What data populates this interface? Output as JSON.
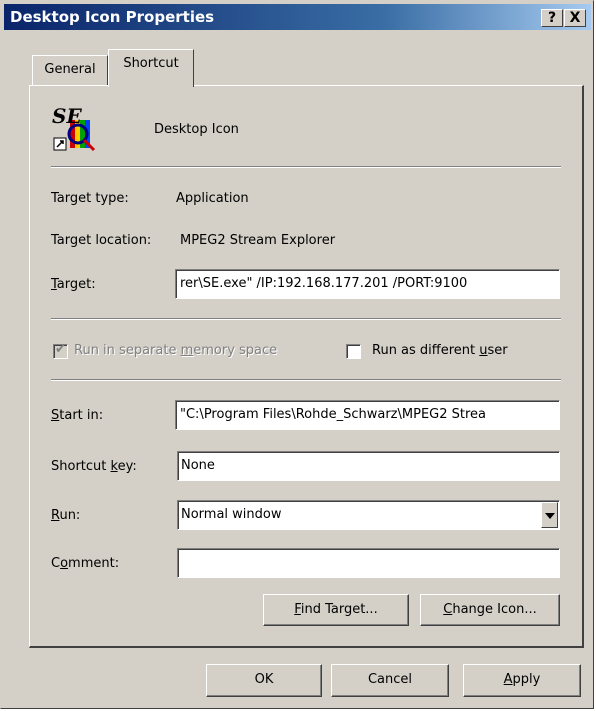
{
  "window": {
    "title": "Desktop Icon Properties",
    "help_label": "?",
    "close_label": "X"
  },
  "tabs": [
    {
      "label": "General"
    },
    {
      "label": "Shortcut"
    }
  ],
  "shortcut": {
    "name": "Desktop Icon",
    "icon_text": "SE",
    "target_type_label": "Target type:",
    "target_type_value": "Application",
    "target_location_label": "Target location:",
    "target_location_value": "MPEG2 Stream Explorer",
    "target_label_pre": "",
    "target_label_u": "T",
    "target_label_post": "arget:",
    "target_value": "rer\\SE.exe\" /IP:192.168.177.201 /PORT:9100",
    "run_separate_pre": "Run in separate ",
    "run_separate_u": "m",
    "run_separate_post": "emory space",
    "run_separate_checked": true,
    "run_as_pre": "Run as different ",
    "run_as_u": "u",
    "run_as_post": "ser",
    "run_as_checked": false,
    "start_in_label_u": "S",
    "start_in_label_post": "tart in:",
    "start_in_value": "\"C:\\Program Files\\Rohde_Schwarz\\MPEG2 Strea",
    "shortcut_key_label_pre": "Shortcut ",
    "shortcut_key_label_u": "k",
    "shortcut_key_label_post": "ey:",
    "shortcut_key_value": "None",
    "run_label_u": "R",
    "run_label_post": "un:",
    "run_value": "Normal window",
    "comment_label_pre": "C",
    "comment_label_u": "o",
    "comment_label_post": "mment:",
    "comment_value": "",
    "find_target_u": "F",
    "find_target_post": "ind Target...",
    "change_icon_u": "C",
    "change_icon_post": "hange Icon..."
  },
  "footer": {
    "ok_label": "OK",
    "cancel_label": "Cancel",
    "apply_u": "A",
    "apply_post": "pply"
  }
}
